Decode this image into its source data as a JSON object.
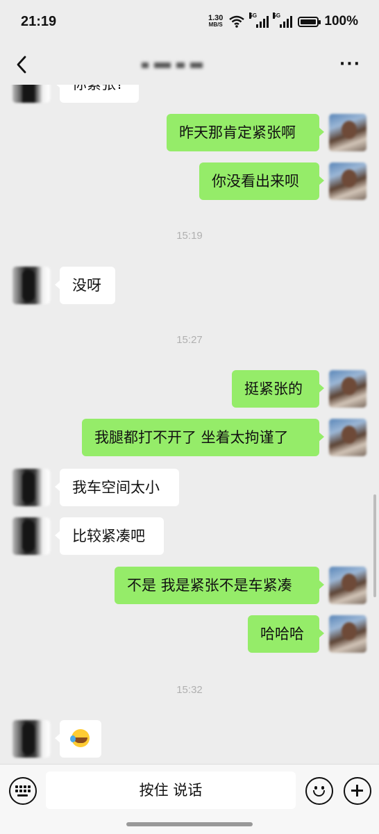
{
  "status_bar": {
    "time": "21:19",
    "net_speed": "1.30",
    "net_unit": "MB/S",
    "sim1": "5G",
    "sim2": "5G",
    "battery": "100%"
  },
  "header": {
    "title": "",
    "back_icon": "chevron-left-icon",
    "more_icon": "ellipsis-icon"
  },
  "messages": [
    {
      "side": "left",
      "text": "你紧张?",
      "partial": true
    },
    {
      "side": "right",
      "text": "昨天那肯定紧张啊"
    },
    {
      "side": "right",
      "text": "你没看出来呗"
    },
    {
      "type": "time",
      "text": "15:19"
    },
    {
      "side": "left",
      "text": "没呀"
    },
    {
      "type": "time",
      "text": "15:27"
    },
    {
      "side": "right",
      "text": "挺紧张的"
    },
    {
      "side": "right",
      "text": "我腿都打不开了 坐着太拘谨了"
    },
    {
      "side": "left",
      "text": "我车空间太小"
    },
    {
      "side": "left",
      "text": "比较紧凑吧"
    },
    {
      "side": "right",
      "text": "不是 我是紧张不是车紧凑"
    },
    {
      "side": "right",
      "text": "哈哈哈"
    },
    {
      "type": "time",
      "text": "15:32"
    },
    {
      "side": "left",
      "emoji": "rolling-on-floor-laughing-emoji"
    }
  ],
  "input_bar": {
    "hold_to_talk": "按住 说话",
    "left_icon": "keyboard-icon",
    "emoji_icon": "smiley-icon",
    "plus_icon": "plus-circle-icon"
  },
  "colors": {
    "background": "#ededed",
    "sent_bubble": "#95ec69",
    "received_bubble": "#ffffff",
    "timestamp": "#b0b0b0"
  }
}
